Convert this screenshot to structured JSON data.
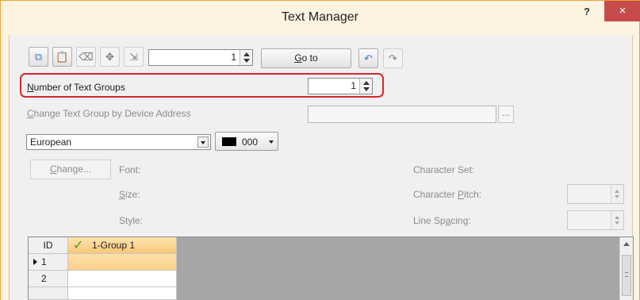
{
  "window": {
    "title": "Text Manager",
    "help_label": "?",
    "close_label": "×",
    "accent_color": "#e8a43a",
    "close_color": "#c74b4b"
  },
  "toolbar": {
    "icons": [
      "copy-icon",
      "paste-icon",
      "clear-icon",
      "import-icon",
      "export-icon"
    ],
    "goto_value": "1",
    "goto_prefix": "G",
    "goto_rest": "o to",
    "undo_icon": "undo-icon",
    "redo_icon": "redo-icon"
  },
  "text_groups": {
    "label_u": "N",
    "label_rest": "umber of Text Groups",
    "value": "1",
    "highlight_color": "#d8262e"
  },
  "device_address": {
    "label_u": "C",
    "label_rest": "hange Text Group by Device Address",
    "value": "",
    "browse_label": "..."
  },
  "language": {
    "selected": "European",
    "color_value": "000",
    "color_swatch": "#000000"
  },
  "font_section": {
    "change_u": "C",
    "change_rest": "hange...",
    "font_label": "Font:",
    "size_u": "S",
    "size_rest": "ize:",
    "style_label": "Style:",
    "charset_label": "Character Set:",
    "pitch_pre": "Character ",
    "pitch_u": "P",
    "pitch_rest": "itch:",
    "spacing_pre": "Line Sp",
    "spacing_u": "a",
    "spacing_rest": "cing:"
  },
  "grid": {
    "id_header": "ID",
    "columns": [
      "1-Group 1"
    ],
    "rows": [
      {
        "id": "1",
        "value": "",
        "current": true
      },
      {
        "id": "2",
        "value": "",
        "current": false
      }
    ]
  }
}
